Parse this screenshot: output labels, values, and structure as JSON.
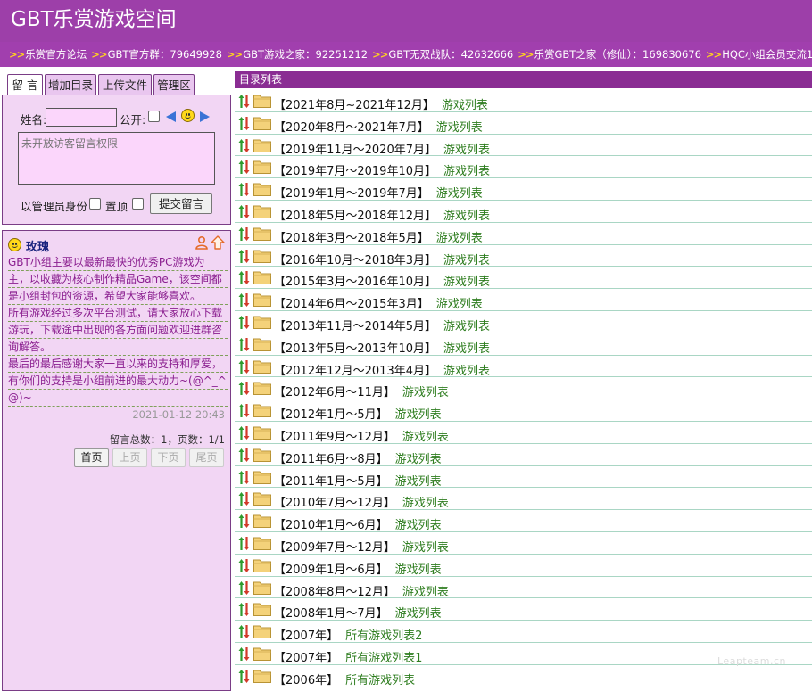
{
  "header": {
    "site_title": "GBT乐赏游戏空间"
  },
  "groups_bar": {
    "items": [
      "乐赏官方论坛",
      "GBT官方群：79649928",
      "GBT游戏之家：92251212",
      "GBT无双战队：42632666",
      "乐赏GBT之家（修仙）：169830676",
      "HQC小组会员交流1群：176"
    ]
  },
  "tabs": [
    {
      "label": "留 言",
      "active": true
    },
    {
      "label": "增加目录",
      "active": false
    },
    {
      "label": "上传文件",
      "active": false
    },
    {
      "label": "管理区",
      "active": false
    }
  ],
  "form": {
    "name_label": "姓名:",
    "public_label": "公开:",
    "textarea_placeholder": "未开放访客留言权限",
    "admin_label": "以管理员身份",
    "pin_label": "置顶",
    "submit_label": "提交留言"
  },
  "message": {
    "author": "玫瑰",
    "lines": [
      "GBT小组主要以最新最快的优秀PC游戏为",
      "主，以收藏为核心制作精品Game，该空间都",
      "是小组封包的资源，希望大家能够喜欢。",
      "所有游戏经过多次平台测试，请大家放心下载",
      "游玩，下载途中出现的各方面问题欢迎进群咨",
      "询解答。",
      "最后的最后感谢大家一直以来的支持和厚爱，",
      "有你们的支持是小组前进的最大动力~(@^_^",
      "@)~"
    ],
    "date": "2021-01-12 20:43"
  },
  "pager": {
    "info": "留言总数：1，页数：1/1",
    "buttons": [
      "首页",
      "上页",
      "下页",
      "尾页"
    ]
  },
  "directory": {
    "header": "目录列表",
    "rows": [
      {
        "label": "【2021年8月~2021年12月】",
        "link": "游戏列表"
      },
      {
        "label": "【2020年8月～2021年7月】",
        "link": "游戏列表"
      },
      {
        "label": "【2019年11月～2020年7月】",
        "link": "游戏列表"
      },
      {
        "label": "【2019年7月～2019年10月】",
        "link": "游戏列表"
      },
      {
        "label": "【2019年1月～2019年7月】",
        "link": "游戏列表"
      },
      {
        "label": "【2018年5月～2018年12月】",
        "link": "游戏列表"
      },
      {
        "label": "【2018年3月～2018年5月】",
        "link": "游戏列表"
      },
      {
        "label": "【2016年10月～2018年3月】",
        "link": "游戏列表"
      },
      {
        "label": "【2015年3月～2016年10月】",
        "link": "游戏列表"
      },
      {
        "label": "【2014年6月～2015年3月】",
        "link": "游戏列表"
      },
      {
        "label": "【2013年11月～2014年5月】",
        "link": "游戏列表"
      },
      {
        "label": "【2013年5月～2013年10月】",
        "link": "游戏列表"
      },
      {
        "label": "【2012年12月～2013年4月】",
        "link": "游戏列表"
      },
      {
        "label": "【2012年6月～11月】",
        "link": "游戏列表"
      },
      {
        "label": "【2012年1月～5月】",
        "link": "游戏列表"
      },
      {
        "label": "【2011年9月～12月】",
        "link": "游戏列表"
      },
      {
        "label": "【2011年6月～8月】",
        "link": "游戏列表"
      },
      {
        "label": "【2011年1月～5月】",
        "link": "游戏列表"
      },
      {
        "label": "【2010年7月～12月】",
        "link": "游戏列表"
      },
      {
        "label": "【2010年1月～6月】",
        "link": "游戏列表"
      },
      {
        "label": "【2009年7月～12月】",
        "link": "游戏列表"
      },
      {
        "label": "【2009年1月～6月】",
        "link": "游戏列表"
      },
      {
        "label": "【2008年8月～12月】",
        "link": "游戏列表"
      },
      {
        "label": "【2008年1月～7月】",
        "link": "游戏列表"
      },
      {
        "label": "【2007年】",
        "link": "所有游戏列表2"
      },
      {
        "label": "【2007年】",
        "link": "所有游戏列表1"
      },
      {
        "label": "【2006年】",
        "link": "所有游戏列表"
      }
    ]
  },
  "watermark": "Leapteam.cn",
  "colors": {
    "header_bg": "#9d3fa9",
    "panel_bg": "#f2d6f4",
    "link_green": "#2e7d1f",
    "message_text": "#8a1e8f",
    "row_divider": "#a9d6c4"
  },
  "icons": {
    "row_sort": "up-down-arrows-icon",
    "row_folder": "folder-icon",
    "emoticon": "smiley-icon",
    "nav_prev": "triangle-left-icon",
    "nav_next": "triangle-right-icon",
    "author_profile": "person-icon",
    "scroll_top": "up-arrow-icon"
  }
}
